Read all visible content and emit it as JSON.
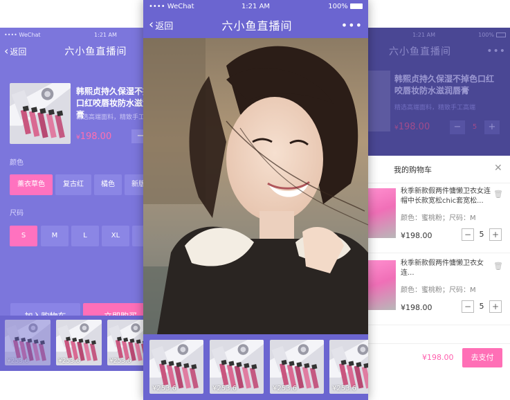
{
  "left": {
    "status": {
      "carrier": "WeChat",
      "time": "1:21 AM"
    },
    "nav": {
      "back": "返回",
      "title": "六小鱼直播间"
    },
    "product": {
      "name": "韩熙贞持久保湿不掉色口红咬唇妆防水滋润唇膏",
      "desc": "精选高端面料，精致手工高",
      "currency": "¥",
      "price": "198.00",
      "minus": "−"
    },
    "color_label": "颜色",
    "colors": [
      "薰衣草色",
      "复古红",
      "橘色",
      "新版"
    ],
    "size_label": "尺码",
    "sizes": [
      "S",
      "M",
      "L",
      "XL",
      "X"
    ],
    "add_cart": "加入购物车",
    "buy_now": "立即购买",
    "strip_prices": [
      "¥253.6",
      "¥253.6",
      "¥253.6"
    ]
  },
  "center": {
    "status": {
      "carrier": "WeChat",
      "time": "1:21 AM",
      "battery": "100%"
    },
    "nav": {
      "back": "返回",
      "title": "六小鱼直播间",
      "more": "•••"
    },
    "strip_prices": [
      "¥253.6",
      "¥253.6",
      "¥253.6",
      "¥253.6"
    ]
  },
  "right": {
    "status": {
      "time": "1:21 AM",
      "battery": "100%"
    },
    "nav": {
      "title": "六小鱼直播间",
      "more": "•••"
    },
    "product": {
      "name_l1": "韩熙贞持久保湿不掉色口红",
      "name_l2": "咬唇妆防水滋润唇膏",
      "desc": "精选高端面料，精致手工高端",
      "currency": "¥",
      "price": "198.00",
      "minus": "−",
      "qty": "5",
      "plus": "+"
    },
    "cart_title": "我的购物车",
    "close": "✕",
    "items": [
      {
        "name": "秋季新款假两件慵懒卫衣女连帽中长款宽松chic套宽松...",
        "spec": "颜色：蜜桃粉；尺码：M",
        "price": "¥198.00",
        "qty": "5",
        "minus": "−",
        "plus": "+"
      },
      {
        "name": "秋季新款假两件慵懒卫衣女连...",
        "spec": "颜色：蜜桃粉；尺码：M",
        "price": "¥198.00",
        "qty": "5",
        "minus": "−",
        "plus": "+"
      }
    ],
    "total": "¥198.00",
    "pay": "去支付"
  },
  "colors": {
    "purple": "#7c76dc",
    "pink": "#ff72bf",
    "dark_overlay": "#4a4794"
  }
}
